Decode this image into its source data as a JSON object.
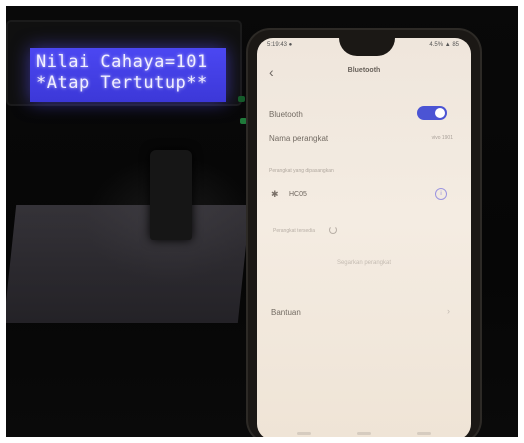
{
  "lcd": {
    "line1": "Nilai Cahaya=101",
    "line2": "*Atap Tertutup**"
  },
  "phone": {
    "status_left": "5:19:43 ●",
    "status_right": "4.5% ▲ 85",
    "title": "Bluetooth",
    "bluetooth_label": "Bluetooth",
    "bluetooth_enabled": true,
    "device_name_label": "Nama perangkat",
    "device_name_value": "vivo 1901",
    "paired_section_label": "Perangkat yang dipasangkan",
    "paired_device": "HC05",
    "available_section_label": "Perangkat tersedia",
    "refresh_label": "Segarkan perangkat",
    "help_label": "Bantuan"
  },
  "colors": {
    "lcd_background": "#4b47f2",
    "toggle_on": "#4b54d4",
    "screen_background": "#efe6dc"
  }
}
